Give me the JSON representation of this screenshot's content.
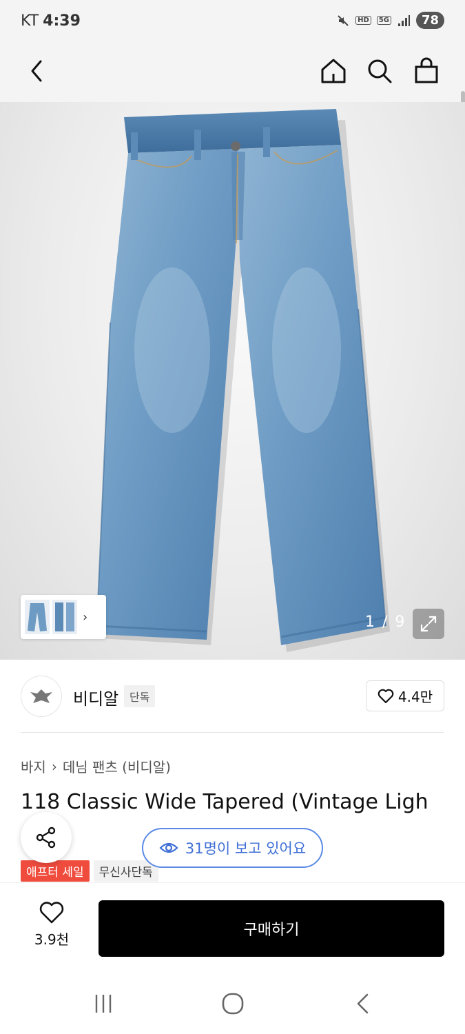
{
  "status_bar": {
    "carrier": "KT",
    "time": "4:39",
    "hd_badge": "HD",
    "network": "5G",
    "battery": "78"
  },
  "nav": {
    "back_icon": "chevron-left-icon",
    "home_icon": "home-icon",
    "search_icon": "search-icon",
    "cart_icon": "shopping-bag-icon"
  },
  "gallery": {
    "counter": "1 / 9",
    "thumb_arrow": "›"
  },
  "brand": {
    "name": "비디알",
    "tag": "단독",
    "like_count": "4.4만"
  },
  "breadcrumb": {
    "category": "바지",
    "separator": "›",
    "subcategory": "데님 팬츠 (비디알)"
  },
  "product": {
    "title": "118 Classic Wide Tapered (Vintage Ligh"
  },
  "viewers": {
    "text": "31명이 보고 있어요"
  },
  "tags": {
    "sale": "애프터 세일",
    "exclusive": "무신사단독"
  },
  "bottom": {
    "like_count": "3.9천",
    "buy_label": "구매하기"
  },
  "colors": {
    "accent_blue": "#3f6fd6",
    "sale_red": "#f04c3e",
    "buy_black": "#000000"
  }
}
